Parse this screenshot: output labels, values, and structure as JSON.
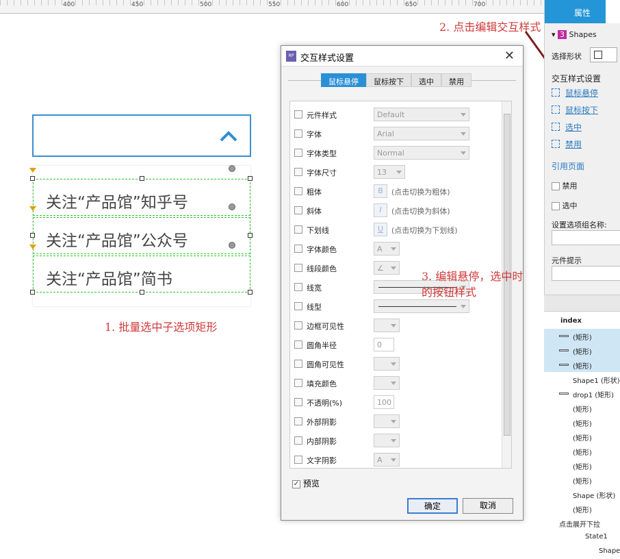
{
  "ruler": {
    "labels": [
      "400",
      "450",
      "500",
      "550",
      "600",
      "650",
      "700"
    ]
  },
  "canvas": {
    "options": [
      "关注“产品馆”知乎号",
      "关注“产品馆”公众号",
      "关注“产品馆”简书"
    ],
    "annotation1": "1. 批量选中子选项矩形",
    "annotation2": "2. 点击编辑交互样式",
    "annotation3_line1": "3. 编辑悬停，选中时",
    "annotation3_line2": "的按钮样式"
  },
  "dialog": {
    "title": "交互样式设置",
    "tabs": [
      "鼠标悬停",
      "鼠标按下",
      "选中",
      "禁用"
    ],
    "rows": [
      {
        "label": "元件样式",
        "value": "Default"
      },
      {
        "label": "字体",
        "value": "Arial"
      },
      {
        "label": "字体类型",
        "value": "Normal"
      },
      {
        "label": "字体尺寸",
        "value": "13"
      },
      {
        "label": "粗体",
        "icon": "B",
        "hint": "(点击切换为粗体)"
      },
      {
        "label": "斜体",
        "icon": "I",
        "hint": "(点击切换为斜体)"
      },
      {
        "label": "下划线",
        "icon": "U",
        "hint": "(点击切换为下划线)"
      },
      {
        "label": "字体颜色",
        "icon": "A"
      },
      {
        "label": "线段颜色",
        "icon": "∠"
      },
      {
        "label": "线宽"
      },
      {
        "label": "线型"
      },
      {
        "label": "边框可见性"
      },
      {
        "label": "圆角半径",
        "value": "0"
      },
      {
        "label": "圆角可见性"
      },
      {
        "label": "填充颜色"
      },
      {
        "label": "不透明(%)",
        "value": "100"
      },
      {
        "label": "外部阴影"
      },
      {
        "label": "内部阴影"
      },
      {
        "label": "文字阴影",
        "icon": "A"
      }
    ],
    "preview": "预览",
    "ok": "确定",
    "cancel": "取消"
  },
  "props": {
    "tab": "属性",
    "count": "3",
    "shapes": "Shapes",
    "select_shape": "选择形状",
    "interaction_styles": "交互样式设置",
    "hover": "鼠标悬停",
    "mousedown": "鼠标按下",
    "selected": "选中",
    "disabled": "禁用",
    "ref_page": "引用页面",
    "cb_disabled": "禁用",
    "cb_selected": "选中",
    "group_name": "设置选项组名称:",
    "tooltip": "元件提示"
  },
  "outline": {
    "page": "index",
    "items": [
      {
        "label": "(矩形)",
        "selected": true
      },
      {
        "label": "(矩形)",
        "selected": true
      },
      {
        "label": "(矩形)",
        "selected": true
      },
      {
        "label": "Shape1 (形状)"
      },
      {
        "label": "drop1 (矩形)"
      },
      {
        "label": "(矩形)"
      },
      {
        "label": "(矩形)"
      },
      {
        "label": "(矩形)"
      },
      {
        "label": "(矩形)"
      },
      {
        "label": "(矩形)"
      },
      {
        "label": "(矩形)"
      },
      {
        "label": "Shape (形状)"
      },
      {
        "label": "(矩形)"
      },
      {
        "label": "点击展开下拉"
      },
      {
        "label": "State1"
      },
      {
        "label": "Shape"
      }
    ]
  }
}
